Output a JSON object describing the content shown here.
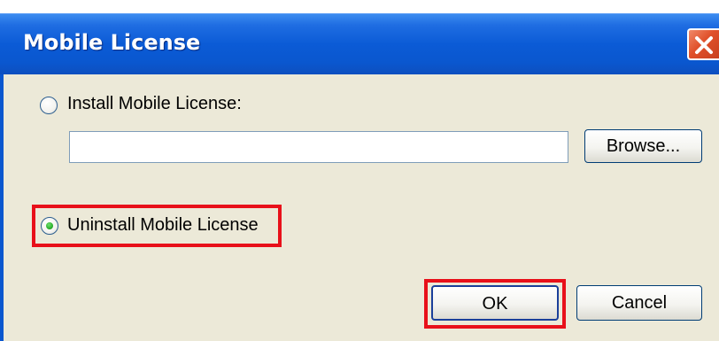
{
  "window": {
    "title": "Mobile License"
  },
  "options": {
    "install_label": "Install Mobile License:",
    "install_selected": false,
    "license_path_value": "",
    "browse_label": "Browse...",
    "uninstall_label": "Uninstall Mobile License",
    "uninstall_selected": true
  },
  "buttons": {
    "ok_label": "OK",
    "cancel_label": "Cancel"
  },
  "colors": {
    "titlebar": "#0a57cf",
    "dialog_face": "#ece9d8",
    "highlight": "#e8101a",
    "radio_dot": "#22a822"
  }
}
